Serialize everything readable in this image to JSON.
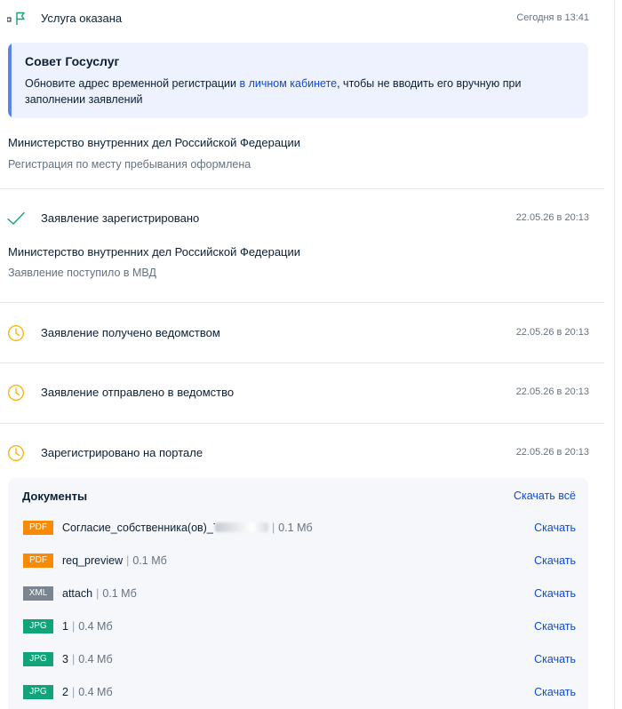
{
  "colors": {
    "pdf": "#f98a06",
    "xml": "#7b8590",
    "jpg": "#11a47b",
    "link": "#0d4cd3",
    "check": "#11a47b",
    "clock": "#f9b612",
    "flag": "#11a47b"
  },
  "events": [
    {
      "icon": "flag-icon",
      "title": "Услуга оказана",
      "time": "Сегодня в 13:41"
    },
    {
      "icon": "check-icon",
      "title": "Заявление зарегистрировано",
      "time": "22.05.26 в 20:13"
    },
    {
      "icon": "clock-icon",
      "title": "Заявление получено ведомством",
      "time": "22.05.26 в 20:13"
    },
    {
      "icon": "clock-icon",
      "title": "Заявление отправлено в ведомство",
      "time": "22.05.26 в 20:13"
    },
    {
      "icon": "clock-icon",
      "title": "Зарегистрировано на портале",
      "time": "22.05.26 в 20:13"
    }
  ],
  "tip": {
    "title": "Совет Госуслуг",
    "text_before": "Обновите адрес временной регистрации ",
    "link": "в личном кабинете",
    "text_after": ", чтобы не вводить его вручную при заполнении заявлений"
  },
  "result": {
    "org": "Министерство внутренних дел Российской Федерации",
    "status": "Регистрация по месту пребывания оформлена"
  },
  "registered": {
    "org": "Министерство внутренних дел Российской Федерации",
    "status": "Заявление поступило в МВД"
  },
  "documents": {
    "title": "Документы",
    "download_all": "Скачать всё",
    "separator": "|",
    "items": [
      {
        "type": "PDF",
        "name": "Согласие_собственника(ов)_74",
        "name_hidden": true,
        "size": "0.1 Мб",
        "action": "Скачать"
      },
      {
        "type": "PDF",
        "name": "req_preview",
        "size": "0.1 Мб",
        "action": "Скачать"
      },
      {
        "type": "XML",
        "name": "attach",
        "size": "0.1 Мб",
        "action": "Скачать"
      },
      {
        "type": "JPG",
        "name": "1",
        "size": "0.4 Мб",
        "action": "Скачать"
      },
      {
        "type": "JPG",
        "name": "3",
        "size": "0.4 Мб",
        "action": "Скачать"
      },
      {
        "type": "JPG",
        "name": "2",
        "size": "0.4 Мб",
        "action": "Скачать"
      }
    ]
  }
}
